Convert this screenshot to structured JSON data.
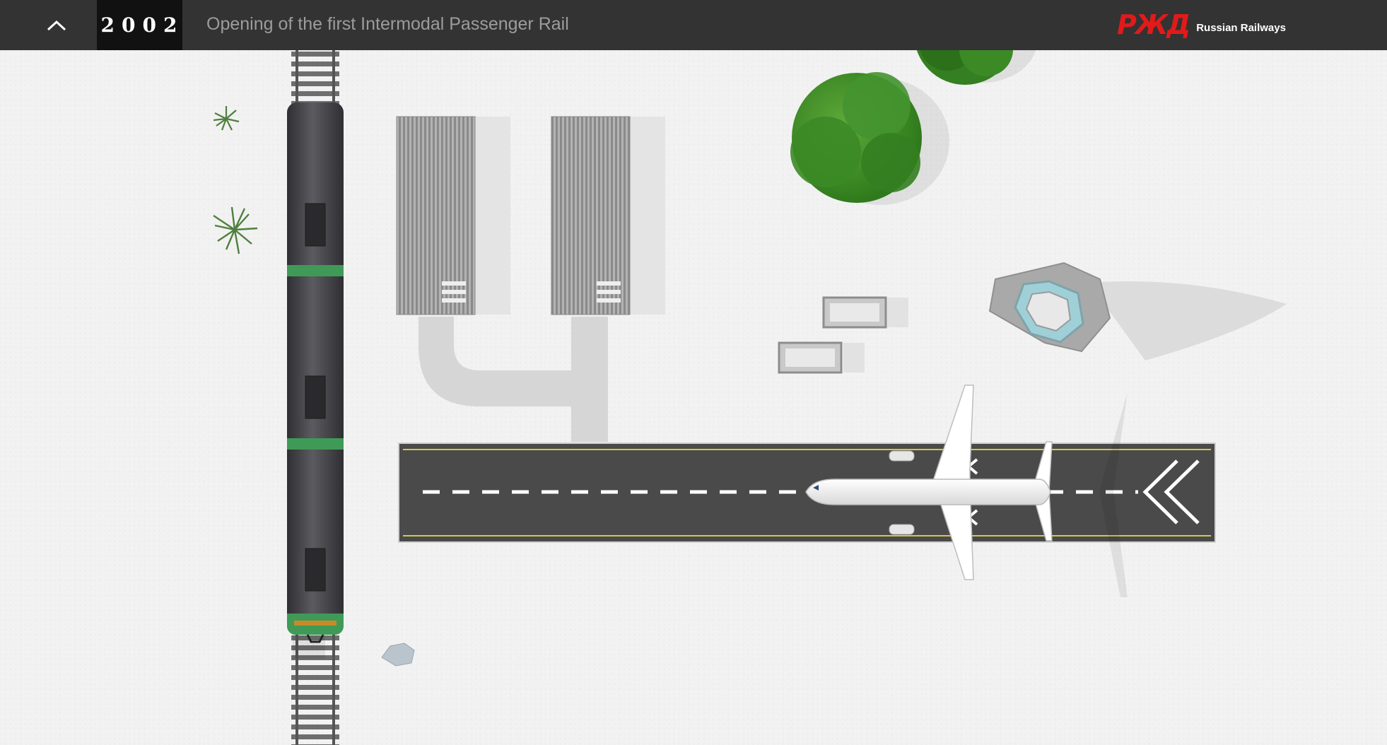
{
  "header": {
    "collapse_icon": "chevron-up-icon",
    "year": "2002",
    "headline": "Opening of the first Intermodal Passenger Rail",
    "logo_mark": "РЖД",
    "logo_text": "Russian Railways"
  },
  "colors": {
    "header_bg": "#333333",
    "year_bg": "#111111",
    "brand_red": "#e21a1a",
    "ground": "#f2f2f2",
    "runway": "#4a4a4a",
    "runway_edge_line": "#d6c54a",
    "train_body": "#4d4d52",
    "train_band": "#3f9a57",
    "tree_green": "#3a8a22"
  },
  "scene": {
    "icons": [
      "train-icon",
      "airplane-icon",
      "runway-icon",
      "tree-icon",
      "shrub-icon",
      "hangar-icon",
      "control-tower-icon",
      "rock-icon",
      "rail-track-icon"
    ]
  }
}
